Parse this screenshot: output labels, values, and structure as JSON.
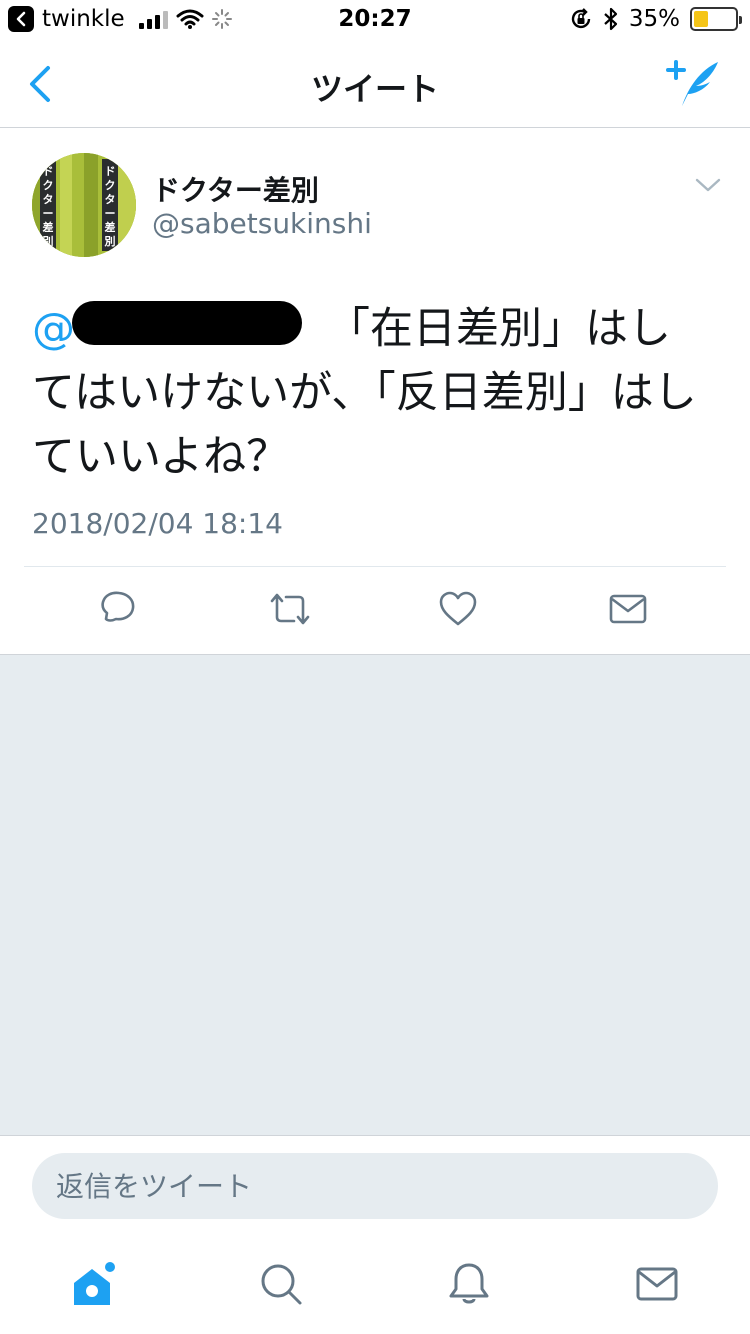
{
  "status_bar": {
    "back_app": "twinkle",
    "time": "20:27",
    "battery": "35%",
    "battery_level": 0.35,
    "icons": [
      "back-app-icon",
      "signal-icon",
      "wifi-icon",
      "loading-icon",
      "rotation-lock-icon",
      "bluetooth-icon",
      "battery-icon"
    ]
  },
  "nav": {
    "title": "ツイート",
    "back_icon": "chevron-left-icon",
    "compose_icon": "compose-tweet-icon"
  },
  "tweet": {
    "display_name": "ドクター差別",
    "handle": "@sabetsukinshi",
    "avatar_text": "ドクター差別",
    "mention": "@",
    "text": "「在日差別」はしてはいけないが、「反日差別」はしていいよね？",
    "timestamp": "2018/02/04 18:14",
    "actions": [
      "reply-icon",
      "retweet-icon",
      "like-icon",
      "dm-icon"
    ]
  },
  "reply": {
    "placeholder": "返信をツイート"
  },
  "tabbar": {
    "items": [
      "home-icon",
      "search-icon",
      "notifications-icon",
      "messages-icon"
    ]
  },
  "colors": {
    "accent": "#1da1f2",
    "text": "#14171a",
    "secondary": "#657786",
    "background_gray": "#e6ecf0"
  }
}
